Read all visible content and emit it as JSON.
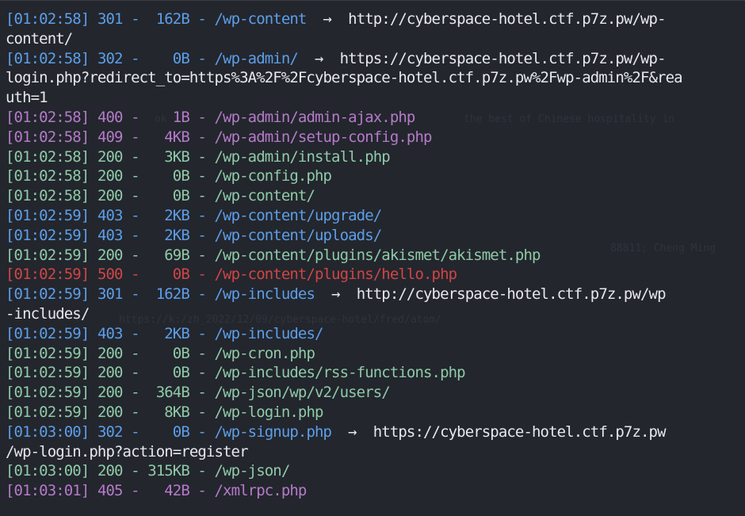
{
  "lines": [
    {
      "time": "[01:02:58]",
      "code": "301",
      "size": "162B",
      "path": "/wp-content",
      "redirect": "http://cyberspace-hotel.ctf.p7z.pw/wp-",
      "wrap": "content/"
    },
    {
      "time": "[01:02:58]",
      "code": "302",
      "size": "0B",
      "path": "/wp-admin/",
      "redirect": "https://cyberspace-hotel.ctf.p7z.pw/wp-",
      "wrap": "login.php?redirect_to=https%3A%2F%2Fcyberspace-hotel.ctf.p7z.pw%2Fwp-admin%2F&rea",
      "wrap2": "uth=1"
    },
    {
      "time": "[01:02:58]",
      "code": "400",
      "size": "1B",
      "path": "/wp-admin/admin-ajax.php"
    },
    {
      "time": "[01:02:58]",
      "code": "409",
      "size": "4KB",
      "path": "/wp-admin/setup-config.php"
    },
    {
      "time": "[01:02:58]",
      "code": "200",
      "size": "3KB",
      "path": "/wp-admin/install.php"
    },
    {
      "time": "[01:02:58]",
      "code": "200",
      "size": "0B",
      "path": "/wp-config.php"
    },
    {
      "time": "[01:02:58]",
      "code": "200",
      "size": "0B",
      "path": "/wp-content/"
    },
    {
      "time": "[01:02:59]",
      "code": "403",
      "size": "2KB",
      "path": "/wp-content/upgrade/"
    },
    {
      "time": "[01:02:59]",
      "code": "403",
      "size": "2KB",
      "path": "/wp-content/uploads/"
    },
    {
      "time": "[01:02:59]",
      "code": "200",
      "size": "69B",
      "path": "/wp-content/plugins/akismet/akismet.php"
    },
    {
      "time": "[01:02:59]",
      "code": "500",
      "size": "0B",
      "path": "/wp-content/plugins/hello.php"
    },
    {
      "time": "[01:02:59]",
      "code": "301",
      "size": "162B",
      "path": "/wp-includes",
      "redirect": "http://cyberspace-hotel.ctf.p7z.pw/wp",
      "wrap": "-includes/"
    },
    {
      "time": "[01:02:59]",
      "code": "403",
      "size": "2KB",
      "path": "/wp-includes/"
    },
    {
      "time": "[01:02:59]",
      "code": "200",
      "size": "0B",
      "path": "/wp-cron.php"
    },
    {
      "time": "[01:02:59]",
      "code": "200",
      "size": "0B",
      "path": "/wp-includes/rss-functions.php"
    },
    {
      "time": "[01:02:59]",
      "code": "200",
      "size": "364B",
      "path": "/wp-json/wp/v2/users/"
    },
    {
      "time": "[01:02:59]",
      "code": "200",
      "size": "8KB",
      "path": "/wp-login.php"
    },
    {
      "time": "[01:03:00]",
      "code": "302",
      "size": "0B",
      "path": "/wp-signup.php",
      "redirect": "https://cyberspace-hotel.ctf.p7z.pw",
      "wrap": "/wp-login.php?action=register"
    },
    {
      "time": "[01:03:00]",
      "code": "200",
      "size": "315KB",
      "path": "/wp-json/"
    },
    {
      "time": "[01:03:01]",
      "code": "405",
      "size": "42B",
      "path": "/xmlrpc.php"
    }
  ],
  "separator": " - ",
  "arrow_glyph": "→",
  "ghost_text": [
    "the best of Chinese hospitality in",
    "ok f",
    "88811; Cheng Ming",
    "https://k:/zh_2022/12/09/cyberspace-hotel/fred/atom/"
  ]
}
